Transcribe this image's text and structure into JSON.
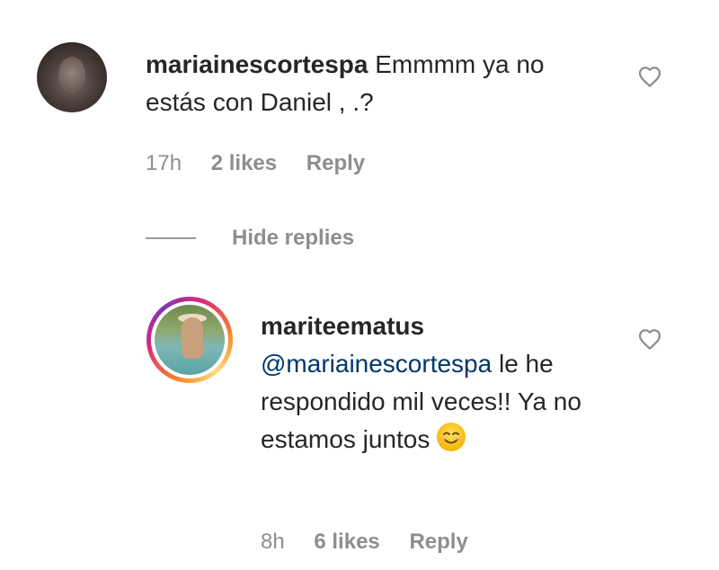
{
  "comment": {
    "username": "mariainescortespa",
    "text": "Emmmm ya no estás con Daniel , .?",
    "time": "17h",
    "likes": "2 likes",
    "reply_label": "Reply"
  },
  "hide_replies_label": "Hide replies",
  "reply": {
    "username": "mariteematus",
    "mention": "@mariainescortespa",
    "text": "le he respondido mil veces!! Ya no estamos juntos",
    "emoji": "smiling-face",
    "time": "8h",
    "likes": "6 likes",
    "reply_label": "Reply"
  },
  "icons": {
    "like": "heart-outline-icon"
  },
  "colors": {
    "text": "#262626",
    "secondary": "#8e8e8e",
    "mention": "#00376b",
    "story_ring": [
      "#f58529",
      "#dd2a7b",
      "#8134af",
      "#feda77"
    ]
  }
}
